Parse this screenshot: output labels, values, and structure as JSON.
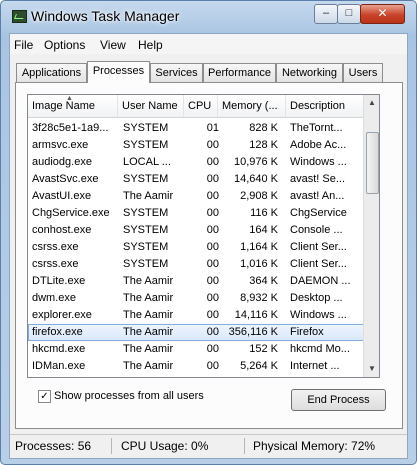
{
  "window": {
    "title": "Windows Task Manager",
    "minimize": "–",
    "maximize": "□",
    "close": "✕"
  },
  "menu": [
    "File",
    "Options",
    "View",
    "Help"
  ],
  "tabs": [
    "Applications",
    "Processes",
    "Services",
    "Performance",
    "Networking",
    "Users"
  ],
  "active_tab": "Processes",
  "columns": {
    "name": "Image Name",
    "user": "User Name",
    "cpu": "CPU",
    "memory": "Memory (...",
    "desc": "Description"
  },
  "rows": [
    {
      "name": "3f28c5e1-1a9...",
      "user": "SYSTEM",
      "cpu": "01",
      "mem": "828 K",
      "desc": "TheTornt..."
    },
    {
      "name": "armsvc.exe",
      "user": "SYSTEM",
      "cpu": "00",
      "mem": "128 K",
      "desc": "Adobe Ac..."
    },
    {
      "name": "audiodg.exe",
      "user": "LOCAL ...",
      "cpu": "00",
      "mem": "10,976 K",
      "desc": "Windows ..."
    },
    {
      "name": "AvastSvc.exe",
      "user": "SYSTEM",
      "cpu": "00",
      "mem": "14,640 K",
      "desc": "avast! Se..."
    },
    {
      "name": "AvastUI.exe",
      "user": "The Aamir",
      "cpu": "00",
      "mem": "2,908 K",
      "desc": "avast! An..."
    },
    {
      "name": "ChgService.exe",
      "user": "SYSTEM",
      "cpu": "00",
      "mem": "116 K",
      "desc": "ChgService"
    },
    {
      "name": "conhost.exe",
      "user": "SYSTEM",
      "cpu": "00",
      "mem": "164 K",
      "desc": "Console ..."
    },
    {
      "name": "csrss.exe",
      "user": "SYSTEM",
      "cpu": "00",
      "mem": "1,164 K",
      "desc": "Client Ser..."
    },
    {
      "name": "csrss.exe",
      "user": "SYSTEM",
      "cpu": "00",
      "mem": "1,016 K",
      "desc": "Client Ser..."
    },
    {
      "name": "DTLite.exe",
      "user": "The Aamir",
      "cpu": "00",
      "mem": "364 K",
      "desc": "DAEMON ..."
    },
    {
      "name": "dwm.exe",
      "user": "The Aamir",
      "cpu": "00",
      "mem": "8,932 K",
      "desc": "Desktop ..."
    },
    {
      "name": "explorer.exe",
      "user": "The Aamir",
      "cpu": "00",
      "mem": "14,116 K",
      "desc": "Windows ..."
    },
    {
      "name": "firefox.exe",
      "user": "The Aamir",
      "cpu": "00",
      "mem": "356,116 K",
      "desc": "Firefox"
    },
    {
      "name": "hkcmd.exe",
      "user": "The Aamir",
      "cpu": "00",
      "mem": "152 K",
      "desc": "hkcmd Mo..."
    },
    {
      "name": "IDMan.exe",
      "user": "The Aamir",
      "cpu": "00",
      "mem": "5,264 K",
      "desc": "Internet ..."
    }
  ],
  "selected_row": "firefox.exe",
  "show_all_users": {
    "label": "Show processes from all users",
    "checked": true
  },
  "end_process": "End Process",
  "status": {
    "processes": "Processes: 56",
    "cpu": "CPU Usage: 0%",
    "memory": "Physical Memory: 72%"
  }
}
